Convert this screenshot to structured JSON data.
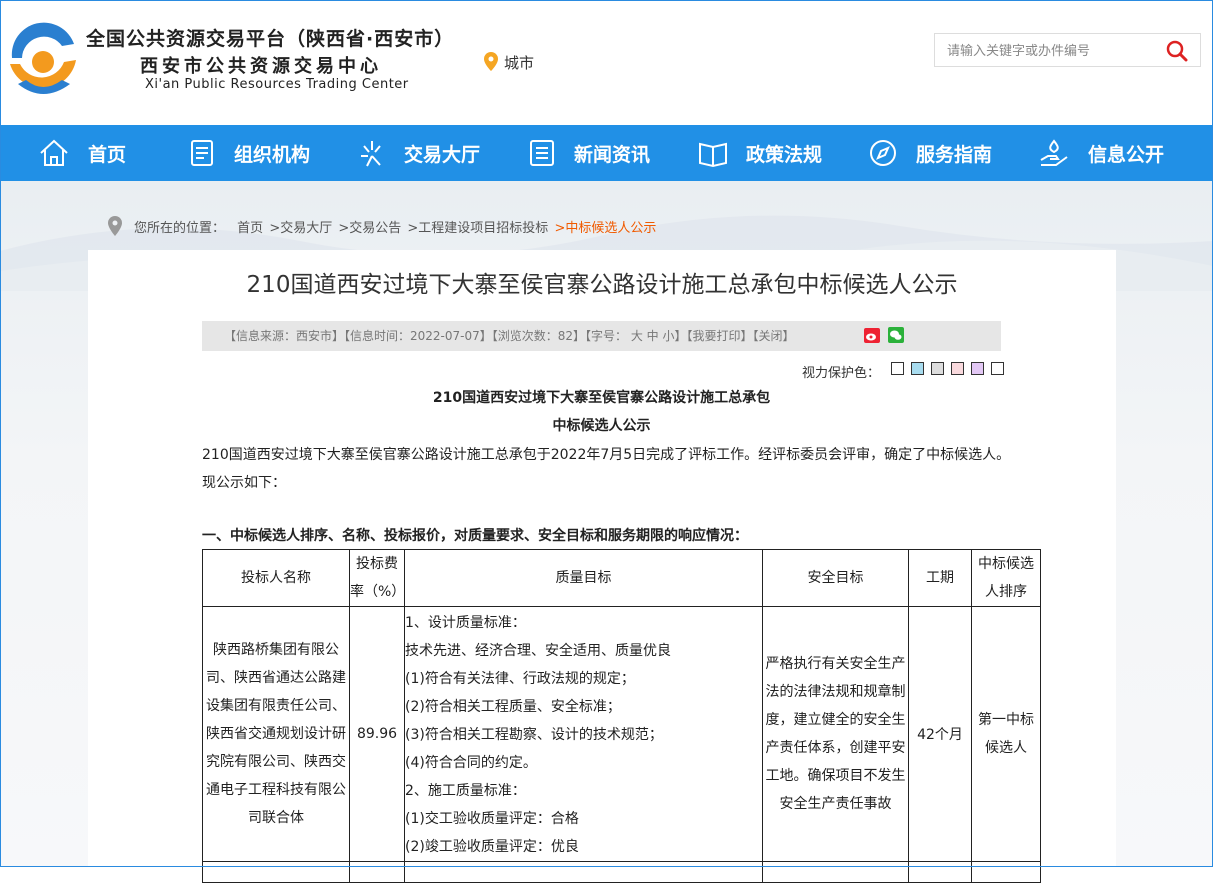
{
  "header": {
    "title_line1": "全国公共资源交易平台（陕西省·西安市）",
    "title_line2": "西安市公共资源交易中心",
    "title_line3": "Xi'an Public Resources Trading Center",
    "city_label": "城市",
    "search_placeholder": "请输入关键字或办件编号"
  },
  "nav": {
    "items": [
      {
        "label": "首页",
        "icon": "home-icon"
      },
      {
        "label": "组织机构",
        "icon": "document-icon"
      },
      {
        "label": "交易大厅",
        "icon": "sparkle-icon"
      },
      {
        "label": "新闻资讯",
        "icon": "list-icon"
      },
      {
        "label": "政策法规",
        "icon": "book-icon"
      },
      {
        "label": "服务指南",
        "icon": "compass-icon"
      },
      {
        "label": "信息公开",
        "icon": "hand-icon"
      }
    ]
  },
  "breadcrumb": {
    "prefix": "您所在的位置：",
    "items": [
      "首页",
      ">交易大厅",
      ">交易公告",
      ">工程建设项目招标投标",
      ">中标候选人公示"
    ]
  },
  "article": {
    "title": "210国道西安过境下大寨至侯官寨公路设计施工总承包中标候选人公示",
    "info": "【信息来源：西安市】【信息时间：2022-07-07】【浏览次数：82】【字号： 大 中 小】【我要打印】【关闭】",
    "eye_label": "视力保护色：",
    "swatch_colors": [
      "#ffffff",
      "#a8dcef",
      "#dddddd",
      "#f9d9dd",
      "#e3c8f5",
      "#ffffff"
    ],
    "heading1": "210国道西安过境下大寨至侯官寨公路设计施工总承包",
    "heading2": "中标候选人公示",
    "paragraph": "210国道西安过境下大寨至侯官寨公路设计施工总承包于2022年7月5日完成了评标工作。经评标委员会评审，确定了中标候选人。现公示如下：",
    "section1": "一、中标候选人排序、名称、投标报价，对质量要求、安全目标和服务期限的响应情况："
  },
  "table": {
    "headers": [
      "投标人名称",
      "投标费率（%）",
      "质量目标",
      "安全目标",
      "工期",
      "中标候选人排序"
    ],
    "row1": {
      "bidder": "陕西路桥集团有限公司、陕西省通达公路建设集团有限责任公司、陕西省交通规划设计研究院有限公司、陕西交通电子工程科技有限公司联合体",
      "rate": "89.96",
      "quality": [
        "1、设计质量标准：",
        "技术先进、经济合理、安全适用、质量优良",
        "(1)符合有关法律、行政法规的规定；",
        "(2)符合相关工程质量、安全标准；",
        "(3)符合相关工程勘察、设计的技术规范；",
        "(4)符合合同的约定。",
        "2、施工质量标准：",
        "(1)交工验收质量评定：合格",
        "(2)竣工验收质量评定：优良"
      ],
      "safety": "严格执行有关安全生产法的法律法规和规章制度，建立健全的安全生产责任体系，创建平安工地。确保项目不发生安全生产责任事故",
      "duration": "42个月",
      "rank": "第一中标候选人"
    }
  }
}
